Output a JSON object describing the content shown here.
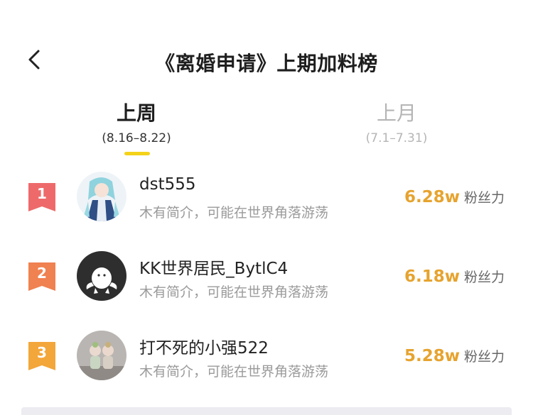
{
  "header": {
    "title": "《离婚申请》上期加料榜"
  },
  "tabs": [
    {
      "label": "上周",
      "range": "(8.16–8.22)",
      "active": true
    },
    {
      "label": "上月",
      "range": "(7.1–7.31)",
      "active": false
    }
  ],
  "ranking": [
    {
      "rank": "1",
      "name": "dst555",
      "bio": "木有简介，可能在世界角落游荡",
      "fan_value": "6.28w",
      "fan_label": "粉丝力",
      "badge_color": "#ee6a6a"
    },
    {
      "rank": "2",
      "name": "KK世界居民_BytlC4",
      "bio": "木有简介，可能在世界角落游荡",
      "fan_value": "6.18w",
      "fan_label": "粉丝力",
      "badge_color": "#f08150"
    },
    {
      "rank": "3",
      "name": "打不死的小强522",
      "bio": "木有简介，可能在世界角落游荡",
      "fan_value": "5.28w",
      "fan_label": "粉丝力",
      "badge_color": "#f3a63a"
    }
  ],
  "colors": {
    "accent": "#f4d21a",
    "fan_value": "#e6a32e"
  },
  "icons": {
    "back": "chevron-left-icon"
  }
}
